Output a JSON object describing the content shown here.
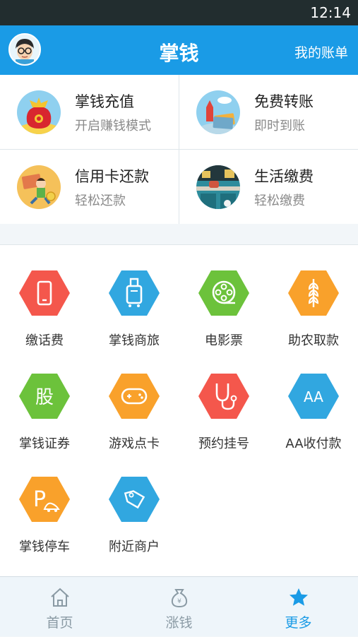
{
  "status_bar": {
    "time": "12:14"
  },
  "header": {
    "title": "掌钱",
    "right_link": "我的账单"
  },
  "quick_actions": [
    {
      "name": "掌钱充值",
      "subtitle": "开启赚钱模式"
    },
    {
      "name": "免费转账",
      "subtitle": "即时到账"
    },
    {
      "name": "信用卡还款",
      "subtitle": "轻松还款"
    },
    {
      "name": "生活缴费",
      "subtitle": "轻松缴费"
    }
  ],
  "services": [
    {
      "label": "缴话费",
      "color": "#f4574c"
    },
    {
      "label": "掌钱商旅",
      "color": "#31a7e0"
    },
    {
      "label": "电影票",
      "color": "#6cc23b"
    },
    {
      "label": "助农取款",
      "color": "#f9a12b"
    },
    {
      "label": "掌钱证券",
      "color": "#6cc23b",
      "glyph": "股"
    },
    {
      "label": "游戏点卡",
      "color": "#f9a12b"
    },
    {
      "label": "预约挂号",
      "color": "#f4574c"
    },
    {
      "label": "AA收付款",
      "color": "#31a7e0",
      "glyph": "AA"
    },
    {
      "label": "掌钱停车",
      "color": "#f9a12b",
      "glyph": "P"
    },
    {
      "label": "附近商户",
      "color": "#31a7e0"
    }
  ],
  "tabs": [
    {
      "label": "首页",
      "active": false
    },
    {
      "label": "涨钱",
      "active": false
    },
    {
      "label": "更多",
      "active": true
    }
  ],
  "colors": {
    "brand": "#1a9be6",
    "tab_active": "#1a9be6",
    "tab_inactive": "#8a9aa4"
  }
}
